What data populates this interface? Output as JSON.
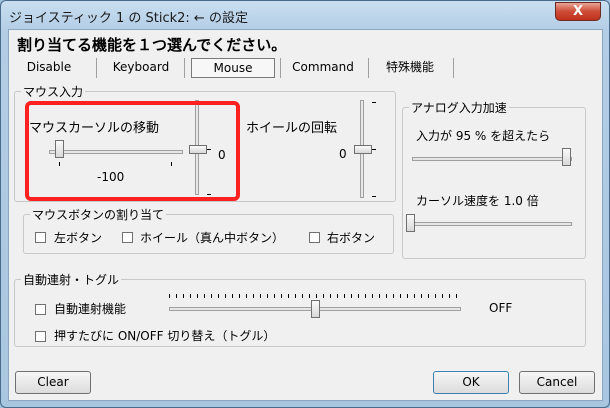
{
  "title": "ジョイスティック 1 の Stick2: ← の設定",
  "close_label": "X",
  "heading": "割り当てる機能を１つ選んでください。",
  "tabs": {
    "disable": "Disable",
    "keyboard": "Keyboard",
    "mouse": "Mouse",
    "command": "Command",
    "special": "特殊機能"
  },
  "mouse_input": {
    "group_label": "マウス入力",
    "cursor_label": "マウスカーソルの移動",
    "cursor_value": "-100",
    "cursor_slider_value_text": "0",
    "wheel_label": "ホイールの回転",
    "wheel_value": "0"
  },
  "analog": {
    "group_label": "アナログ入力加速",
    "threshold_label": "入力が 95 % を超えたら",
    "speed_label": "カーソル速度を 1.0 倍"
  },
  "mouse_buttons": {
    "group_label": "マウスボタンの割り当て",
    "left": "左ボタン",
    "wheel": "ホイール（真ん中ボタン）",
    "right": "右ボタン"
  },
  "autofire": {
    "group_label": "自動連射・トグル",
    "autofire_label": "自動連射機能",
    "autofire_state": "OFF",
    "toggle_label": "押すたびに ON/OFF 切り替え（トグル）"
  },
  "buttons": {
    "clear": "Clear",
    "ok": "OK",
    "cancel": "Cancel"
  }
}
